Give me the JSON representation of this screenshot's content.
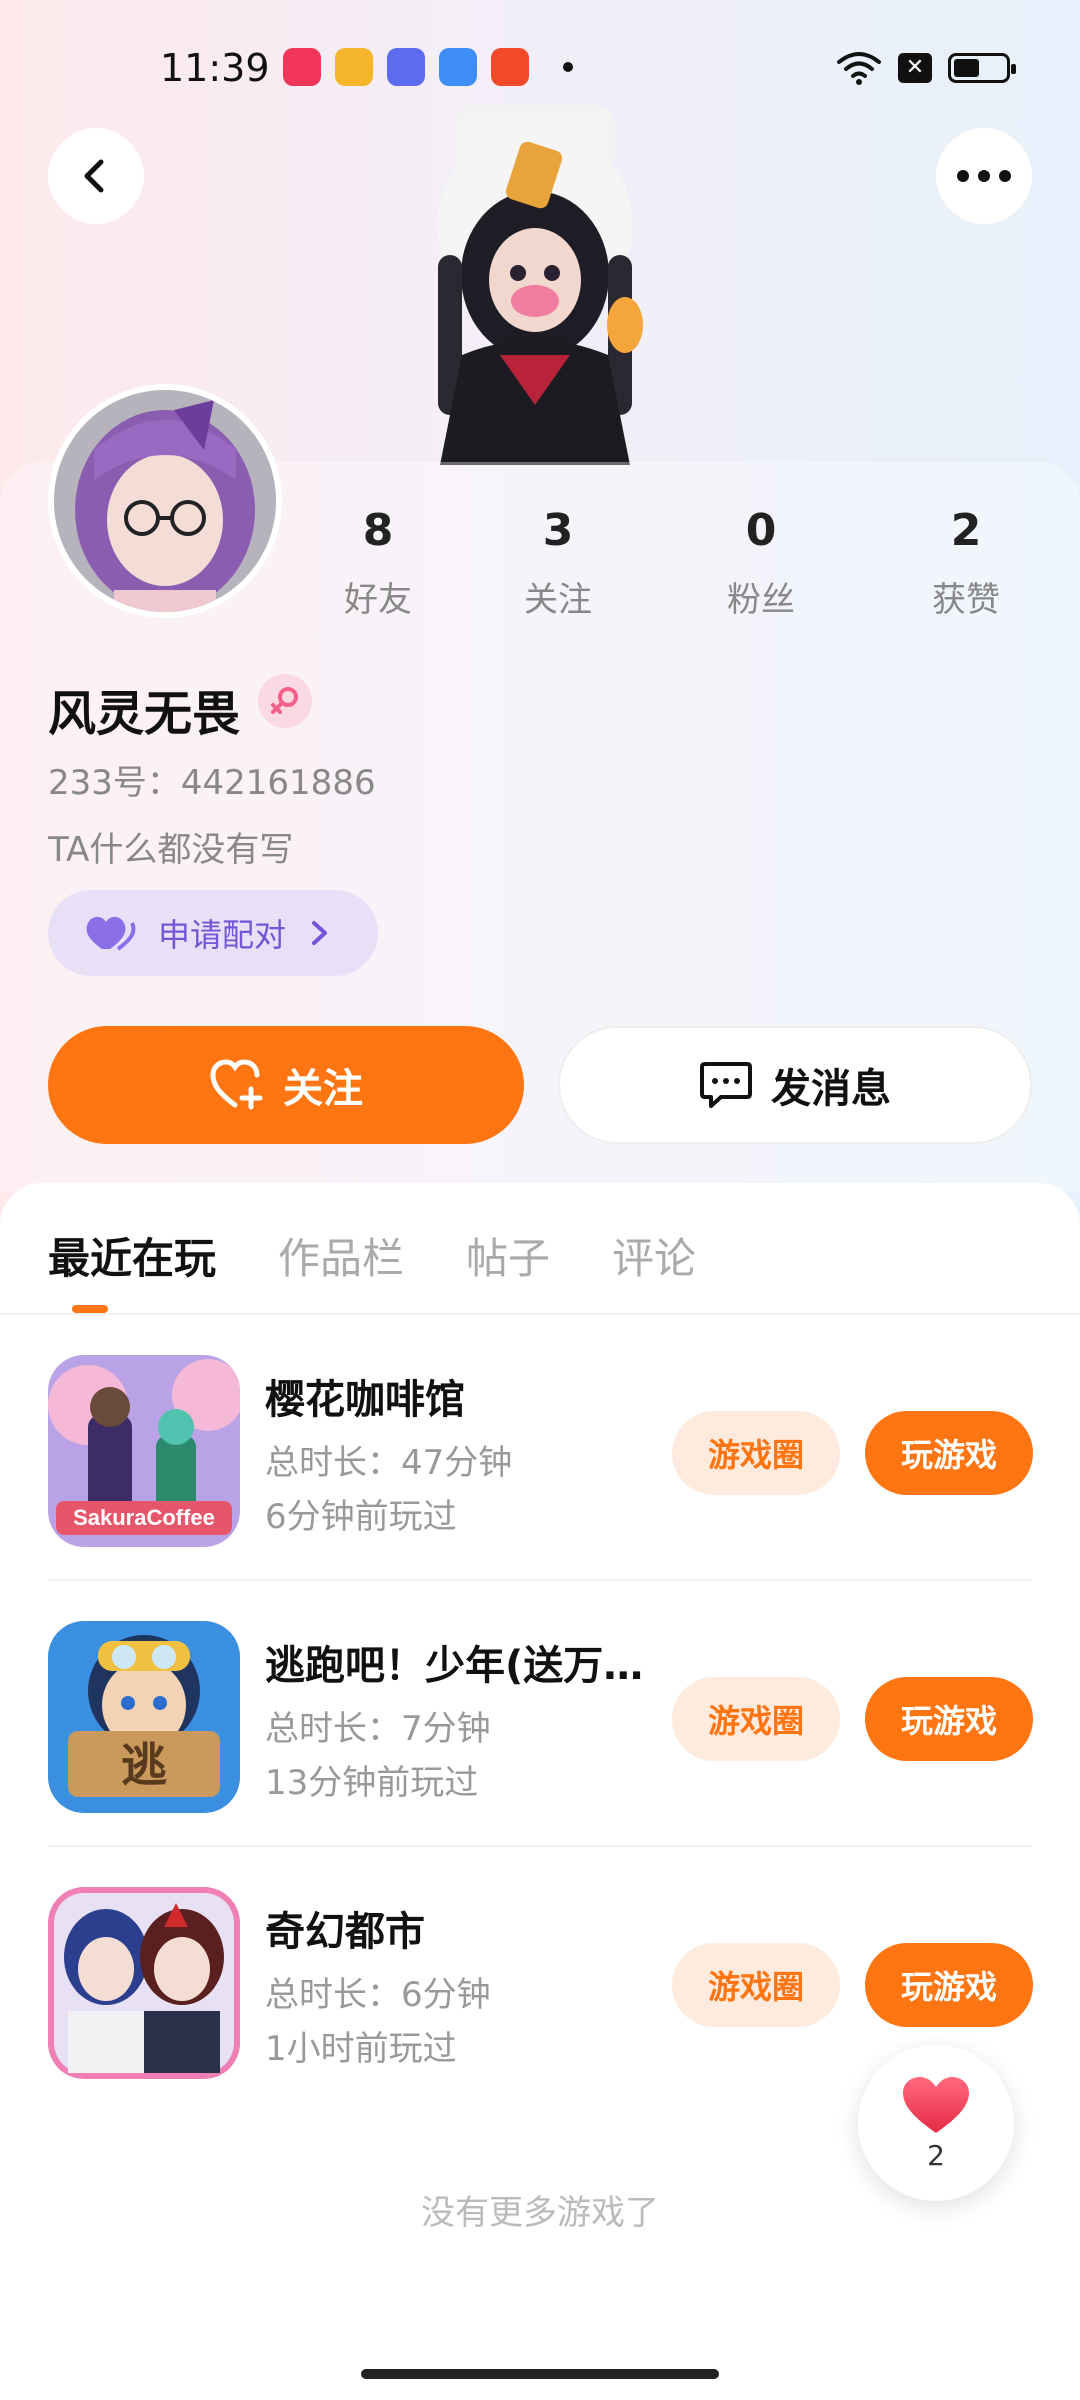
{
  "status_bar": {
    "time": "11:39",
    "app_icons": [
      {
        "name": "music-app-icon",
        "color": "#f2365b"
      },
      {
        "name": "weibo-app-icon",
        "color": "#f4b52a"
      },
      {
        "name": "shortcut-app-icon",
        "color": "#5b6cf0"
      },
      {
        "name": "feather-app-icon",
        "color": "#3f8ef7"
      },
      {
        "name": "video-app-icon",
        "color": "#f2492b"
      }
    ]
  },
  "profile": {
    "stats": [
      {
        "value": "8",
        "label": "好友"
      },
      {
        "value": "3",
        "label": "关注"
      },
      {
        "value": "0",
        "label": "粉丝"
      },
      {
        "value": "2",
        "label": "获赞"
      }
    ],
    "nickname": "风灵无畏",
    "gender": "female",
    "uid": "233号：442161886",
    "bio": "TA什么都没有写",
    "pair_button": "申请配对"
  },
  "actions": {
    "follow": "关注",
    "message": "发消息"
  },
  "tabs": [
    "最近在玩",
    "作品栏",
    "帖子",
    "评论"
  ],
  "active_tab": "最近在玩",
  "games": [
    {
      "name": "樱花咖啡馆",
      "duration": "总时长：47分钟",
      "last_played": "6分钟前玩过",
      "circle": "游戏圈",
      "play": "玩游戏"
    },
    {
      "name": "逃跑吧！少年(送万…",
      "duration": "总时长：7分钟",
      "last_played": "13分钟前玩过",
      "circle": "游戏圈",
      "play": "玩游戏"
    },
    {
      "name": "奇幻都市",
      "duration": "总时长：6分钟",
      "last_played": "1小时前玩过",
      "circle": "游戏圈",
      "play": "玩游戏"
    }
  ],
  "no_more": "没有更多游戏了",
  "likes": "2",
  "colors": {
    "accent": "#ff7512",
    "pair_purple": "#7555d6",
    "like_red": "#f0364f"
  }
}
